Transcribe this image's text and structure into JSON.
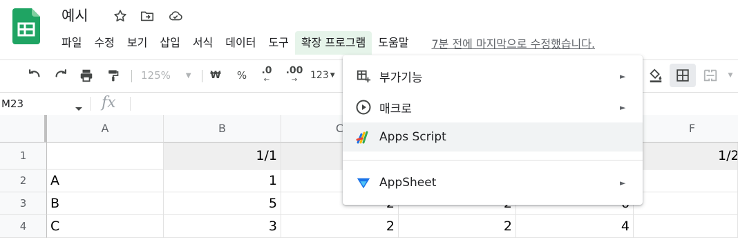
{
  "app": {
    "title": "예시",
    "menu": [
      "파일",
      "수정",
      "보기",
      "삽입",
      "서식",
      "데이터",
      "도구",
      "확장 프로그램",
      "도움말"
    ],
    "last_edit": "7분 전에 마지막으로 수정했습니다.",
    "accent": "#188038"
  },
  "toolbar": {
    "zoom": "125%",
    "currency": "₩",
    "percent": "%",
    "dec_decrease": ".0",
    "dec_increase": ".00",
    "number_format": "123"
  },
  "formula_bar": {
    "cell_ref": "M23",
    "fx": "fx"
  },
  "grid": {
    "columns": [
      "A",
      "B",
      "C",
      "F"
    ],
    "rows": [
      {
        "num": "1",
        "cells": [
          "",
          "1/1",
          "",
          "",
          "",
          "1/2"
        ]
      },
      {
        "num": "2",
        "cells": [
          "A",
          "1",
          "",
          "",
          "",
          ""
        ]
      },
      {
        "num": "3",
        "cells": [
          "B",
          "5",
          "2",
          "2",
          "6",
          ""
        ]
      },
      {
        "num": "4",
        "cells": [
          "C",
          "3",
          "2",
          "2",
          "4",
          ""
        ]
      }
    ]
  },
  "extensions_menu": {
    "items": [
      {
        "label": "부가기능",
        "icon": "addon-icon",
        "submenu": true
      },
      {
        "label": "매크로",
        "icon": "play-circle-icon",
        "submenu": true
      },
      {
        "label": "Apps Script",
        "icon": "apps-script-icon",
        "submenu": false
      },
      {
        "label": "AppSheet",
        "icon": "appsheet-icon",
        "submenu": true
      }
    ],
    "submenu_glyph": "►"
  }
}
